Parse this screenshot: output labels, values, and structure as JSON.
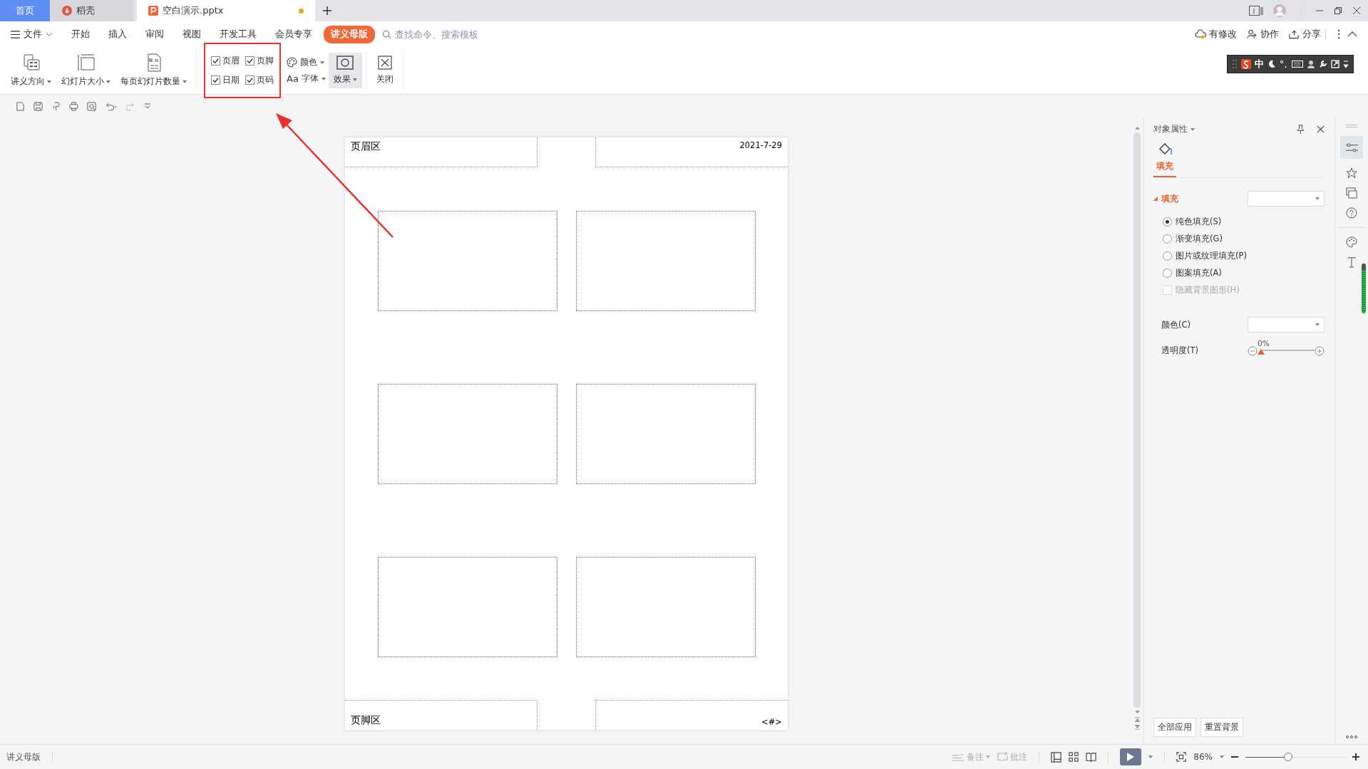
{
  "tabs": [
    {
      "label": "首页",
      "kind": "home",
      "selected": false
    },
    {
      "label": "稻壳",
      "kind": "docer",
      "selected": false
    },
    {
      "label": "空白演示.pptx",
      "kind": "doc",
      "selected": true,
      "modified": true
    }
  ],
  "menu": {
    "items": [
      {
        "label": "文件",
        "kind": "file"
      },
      {
        "label": "开始",
        "kind": "plain",
        "selected": false
      },
      {
        "label": "插入",
        "kind": "plain",
        "selected": false
      },
      {
        "label": "审阅",
        "kind": "plain",
        "selected": false
      },
      {
        "label": "视图",
        "kind": "plain",
        "selected": false
      },
      {
        "label": "开发工具",
        "kind": "plain",
        "selected": false
      },
      {
        "label": "会员专享",
        "kind": "plain",
        "selected": false
      },
      {
        "label": "讲义母版",
        "kind": "plain",
        "selected": true
      }
    ],
    "search": {
      "placeholder": "查找命令、搜索模板"
    },
    "actions": [
      {
        "label": "有修改",
        "kind": "cloud"
      },
      {
        "label": "协作",
        "kind": "user"
      },
      {
        "label": "分享",
        "kind": "share"
      }
    ]
  },
  "ribbon": {
    "buttons": [
      {
        "label": "讲义方向",
        "kind": "orientation"
      },
      {
        "label": "幻灯片大小",
        "kind": "size"
      },
      {
        "label": "每页幻灯片数量",
        "kind": "count"
      }
    ],
    "checkboxes": [
      {
        "label": "页眉",
        "checked": true
      },
      {
        "label": "页脚",
        "checked": true
      },
      {
        "label": "日期",
        "checked": true
      },
      {
        "label": "页码",
        "checked": true
      }
    ],
    "theme": [
      {
        "label": "颜色",
        "kind": "palette"
      },
      {
        "prefix": "Aa",
        "label": "字体",
        "kind": "font"
      }
    ],
    "effects": {
      "label": "效果",
      "selected": true
    },
    "close": {
      "label": "关闭"
    }
  },
  "ime_bar": {
    "mode": "中"
  },
  "slide": {
    "header_left": "页眉区",
    "header_right": "2021-7-29",
    "footer_left": "页脚区",
    "footer_right": "<#>"
  },
  "panel": {
    "title": "对象属性",
    "tab": {
      "label": "填充",
      "selected": true
    },
    "section": "填充",
    "options": [
      {
        "label": "纯色填充(S)",
        "selected": true
      },
      {
        "label": "渐变填充(G)",
        "selected": false
      },
      {
        "label": "图片或纹理填充(P)",
        "selected": false
      },
      {
        "label": "图案填充(A)",
        "selected": false
      }
    ],
    "hide_background": {
      "label": "隐藏背景图形(H)",
      "checked": false,
      "disabled": true
    },
    "color_label": "颜色(C)",
    "transparency": {
      "label": "透明度(T)",
      "reading": "0%",
      "level": 0
    },
    "buttons": [
      "全部应用",
      "重置背景"
    ]
  },
  "status_bar": {
    "mode": "讲义母版",
    "notes": "备注",
    "comments": "批注",
    "zoom": "86%",
    "level": 0.42
  }
}
